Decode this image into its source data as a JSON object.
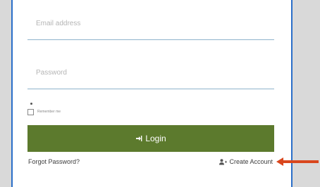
{
  "form": {
    "email_placeholder": "Email address",
    "password_placeholder": "Password",
    "remember_label": "Remember me",
    "login_label": "Login",
    "forgot_label": "Forgot Password?",
    "create_label": "Create Account"
  },
  "icons": {
    "login": "sign-in-icon",
    "create": "user-plus-icon",
    "annotation": "arrow-left-icon"
  },
  "colors": {
    "login_button": "#5c7a2d",
    "card_border": "#2a6fc9",
    "arrow": "#d9471e"
  }
}
